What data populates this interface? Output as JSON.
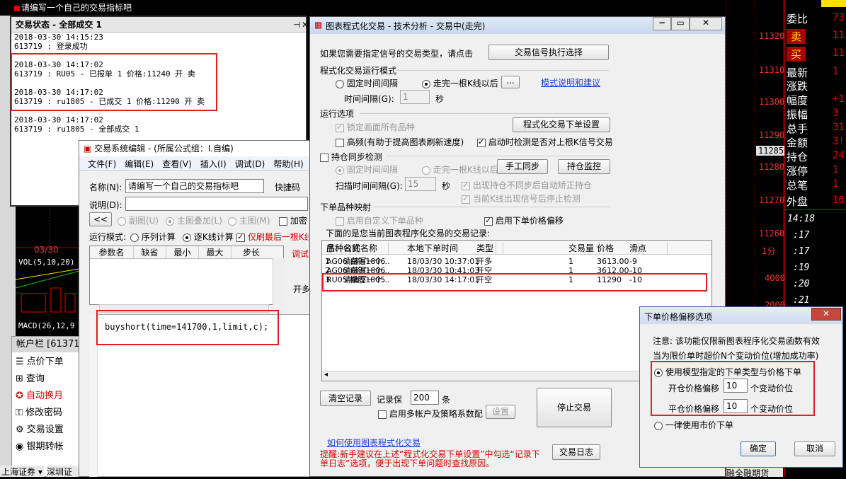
{
  "background": {
    "top_text": "请编写一个自己的交易指标吧",
    "price_axis": [
      "11320",
      "11310",
      "11300",
      "11290",
      "11285",
      "11280",
      "11270",
      "11260"
    ],
    "minute_label": "1分",
    "vol_axis": [
      "4000",
      "2000"
    ],
    "side_rows": [
      {
        "label": "委比",
        "value": "73"
      },
      {
        "label": "卖",
        "value": "11"
      },
      {
        "label": "买",
        "value": "11"
      },
      {
        "label": "最新",
        "value": "1"
      },
      {
        "label": "涨跌",
        "value": ""
      },
      {
        "label": "幅度",
        "value": "+1"
      },
      {
        "label": "振幅",
        "value": "3"
      },
      {
        "label": "总手",
        "value": "31"
      },
      {
        "label": "金额",
        "value": "3!"
      },
      {
        "label": "持仓",
        "value": "24!"
      },
      {
        "label": "涨停",
        "value": "1"
      },
      {
        "label": "总笔",
        "value": "1"
      },
      {
        "label": "外盘",
        "value": "16"
      }
    ],
    "tape": [
      "14:18",
      ":17",
      ":17",
      ":19",
      ":20",
      ":21",
      ":22"
    ],
    "chart_date": "03/30",
    "vol_label": "VOL(5,10,20)",
    "macd_label": "MACD(26,12,9",
    "account_bar": "帐户栏 [61371",
    "account_items": [
      "点价下单",
      "查询",
      "自动换月",
      "修改密码",
      "交易设置",
      "银期转帐"
    ],
    "bottom_left": "上海证券",
    "bottom_left2": "深圳证",
    "bottom_right": "融全融期货"
  },
  "status_window": {
    "title": "交易状态 - 全部成交 1",
    "lines": [
      "2018-03-30 14:15:23",
      "613719 : 登录成功",
      "",
      "2018-03-30 14:17:02",
      "613719 : RU05 - 已报单 1 价格:11240 开 卖",
      "",
      "2018-03-30 14:17:02",
      "613719 : ru1805 - 已成交 1 价格:11290 开 卖",
      "",
      "2018-03-30 14:17:02",
      "613719 : ru1805 - 全部成交 1"
    ]
  },
  "editor_window": {
    "title": "交易系统编辑 - (所属公式组：I.自编)",
    "menu": [
      "文件(F)",
      "编辑(E)",
      "查看(V)",
      "插入(I)",
      "调试(D)",
      "帮助(H)"
    ],
    "name_label": "名称(N):",
    "name_value": "请编写一个自己的交易指标吧",
    "shortcut_label": "快捷码",
    "desc_label": "说明(D):",
    "back_btn": "<<",
    "mode_opts": [
      "副图(U)",
      "主图叠加(L)",
      "主图(M)"
    ],
    "encrypt_label": "加密",
    "run_mode_label": "运行模式:",
    "run_opts": [
      "序列计算",
      "逐K线计算"
    ],
    "signal_label": "仅刷最后一根K线",
    "param_headers": [
      "参数名",
      "缺省",
      "最小",
      "最大",
      "步长"
    ],
    "debug_label": "调试",
    "open_label": "开多",
    "code": "buyshort(time=141700,1,limit,c);"
  },
  "main_window": {
    "title": "图表程式化交易 - 技术分析 - 交易中(走完)",
    "intro": "如果您需要指定信号的交易类型，请点击",
    "signal_type_btn": "交易信号执行选择",
    "run_mode_group": "程式化交易运行模式",
    "fixed_interval": "固定时间间隔",
    "after_kline": "走完一根K线以后",
    "dots_btn": "...",
    "mode_link": "模式说明和建议",
    "interval_label": "时间间隔(G):",
    "interval_value": "1",
    "sec": "秒",
    "options_group": "运行选项",
    "lock_label": "锁定画面所有品种",
    "order_settings_btn": "程式化交易下单设置",
    "hf_label": "高频(有助于提高图表刷新速度)",
    "check_label": "启动时检测是否对上根K信号交易",
    "sync_label": "持仓同步检测",
    "sync_fixed": "固定时间间隔",
    "sync_after": "走完一根K线以后",
    "manual_sync_btn": "手工同步",
    "pos_monitor_btn": "持仓监控",
    "scan_label": "扫描时间间隔(G):",
    "scan_value": "15",
    "scan_sec": "秒",
    "mismatch_label": "出现持仓不同步后自动矫正持仓",
    "stop_label": "当前K线出现信号后停止检测",
    "mapping_group": "下单品种映射",
    "custom_label": "启用自定义下单品种",
    "offset_label": "启用下单价格偏移",
    "records_label": "下面的是您当前图表程序化交易的交易记录:",
    "table_headers": [
      "序.",
      "品种名称",
      "公式名称",
      "本地下单时间",
      "类型",
      "交易量",
      "价格",
      "滑点"
    ],
    "rows": [
      [
        "1",
        "AG06 白银1806",
        "请编写一个...",
        "18/03/30 10:37:01",
        "开多",
        "1",
        "3613.00",
        "-9"
      ],
      [
        "2",
        "AG06 白银1806",
        "请编写一个...",
        "18/03/30 10:41:03",
        "开空",
        "1",
        "3612.00",
        "-10"
      ],
      [
        "3",
        "RU05 橡胶1805",
        "请编写一个...",
        "18/03/30 14:17:01",
        "开空",
        "1",
        "11290",
        "-10"
      ]
    ],
    "clear_btn": "清空记录",
    "keep_label": "记录保",
    "keep_value": "200",
    "keep_unit": "条",
    "multi_label": "启用多帐户及策略系数配",
    "setup_btn": "设置",
    "stop_btn": "停止交易",
    "help_link": "如何使用图表程式化交易",
    "log_btn": "交易日志",
    "tip": "提醒:新手建议在上述“程式化交易下单设置”中勾选“记录下单日志”选项，便于出现下单问题时查找原因。"
  },
  "offset_dialog": {
    "title": "下单价格偏移选项",
    "note1": "注意: 该功能仅限新图表程序化交易函数有效",
    "note2": "当为限价单时超价N个变动价位(增加成功率)",
    "opt1": "使用模型指定的下单类型与价格下单",
    "open_label": "开仓价格偏移",
    "open_value": "10",
    "close_label": "平仓价格偏移",
    "close_value": "10",
    "unit": "个变动价位",
    "opt2": "一律使用市价下单",
    "ok_btn": "确定",
    "cancel_btn": "取消"
  },
  "colors": {
    "accent_red": "#e02020",
    "title_blue": "#cfe0f5",
    "market_red": "#e00000"
  }
}
